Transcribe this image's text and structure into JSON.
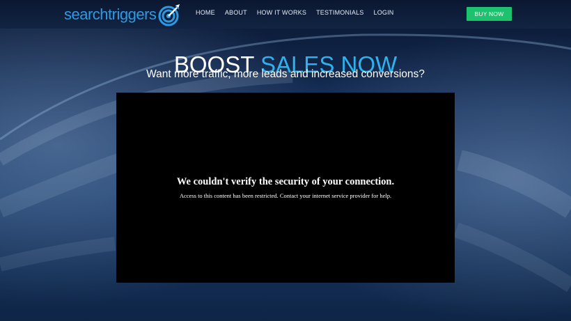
{
  "brand": {
    "part1": "search",
    "part2": "triggers",
    "color": "#2c9be6",
    "icon": "target-arrow-icon"
  },
  "nav": {
    "items": [
      {
        "label": "HOME"
      },
      {
        "label": "ABOUT"
      },
      {
        "label": "HOW IT WORKS"
      },
      {
        "label": "TESTIMONIALS"
      },
      {
        "label": "LOGIN"
      }
    ]
  },
  "cta": {
    "buy_label": "BUY NOW",
    "color": "#1dc26e"
  },
  "hero": {
    "headline_part1": "BOOST",
    "headline_part2": "SALES NOW",
    "accent_color": "#2fb1ec",
    "subheadline": "Want more traffic, more leads and increased conversions?"
  },
  "video_panel": {
    "error_title": "We couldn't verify the security of your connection.",
    "error_message": "Access to this content has been restricted. Contact your internet service provider for help."
  }
}
